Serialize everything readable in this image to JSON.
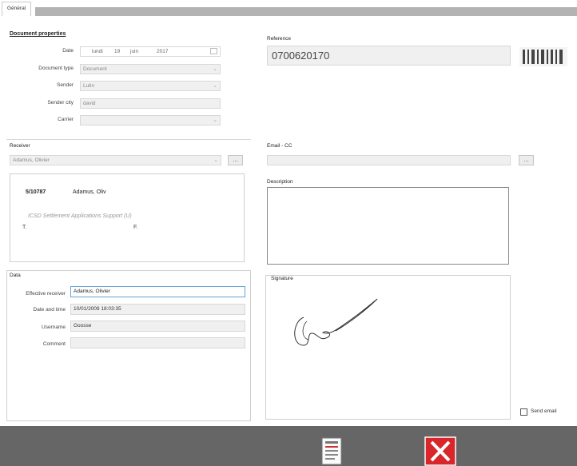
{
  "tab": {
    "general_label": "Général"
  },
  "doc_props": {
    "title": "Document properties",
    "date_label": "Date",
    "date_day": "lundi",
    "date_num": "19",
    "date_month": "juin",
    "date_year": "2017",
    "doctype_label": "Document type",
    "doctype_value": "Document",
    "sender_label": "Sender",
    "sender_value": "Lutin",
    "sender_city_label": "Sender city",
    "sender_city_value": "david",
    "carrier_label": "Carrier",
    "carrier_value": ""
  },
  "reference": {
    "label": "Reference",
    "value": "0700620170",
    "barcode_icon": "barcode-icon"
  },
  "receiver": {
    "title": "Receiver",
    "select_value": "Adamus, Olivier",
    "button_label": "...",
    "card_id": "5/10787",
    "card_name": "Adamus, Oliv",
    "card_dept": "ICSD Settlement Applications Support (U)",
    "card_t": "T.",
    "card_f": "F."
  },
  "email_cc": {
    "label": "Email - CC",
    "value": "",
    "button_label": "..."
  },
  "description": {
    "label": "Description",
    "value": ""
  },
  "data": {
    "title": "Data",
    "effective_receiver_label": "Effective receiver",
    "effective_receiver_value": "Adamus, Olivier",
    "datetime_label": "Date and time",
    "datetime_value": "10/01/2009 18:03:35",
    "username_label": "Username",
    "username_value": "Goosse",
    "comment_label": "Comment",
    "comment_value": ""
  },
  "signature": {
    "label": "Signature"
  },
  "send_email": {
    "label": "Send email",
    "checked": false
  },
  "footer": {
    "report_icon": "report-icon",
    "close_icon": "close-icon"
  }
}
